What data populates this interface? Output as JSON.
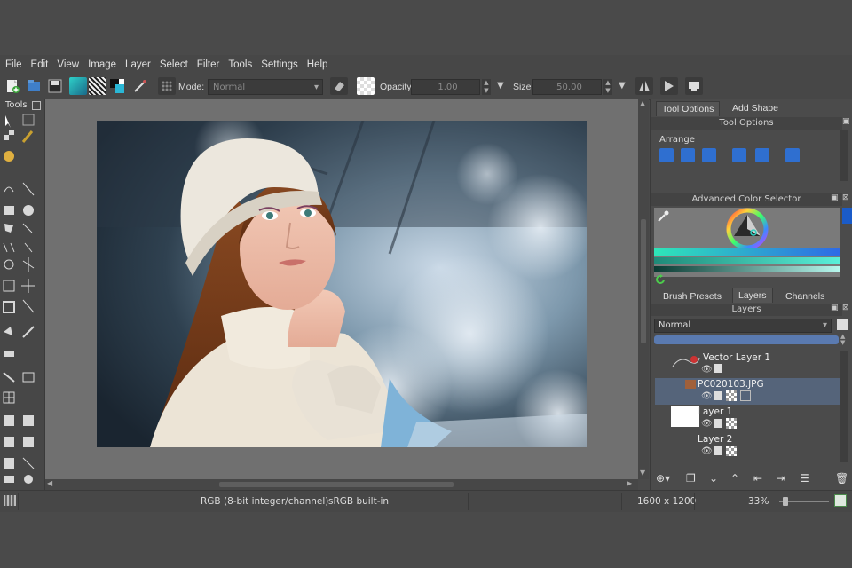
{
  "menu": [
    "File",
    "Edit",
    "View",
    "Image",
    "Layer",
    "Select",
    "Filter",
    "Tools",
    "Settings",
    "Help"
  ],
  "toolbar": {
    "mode_label": "Mode:",
    "mode_value": "Normal",
    "opacity_label": "Opacity:",
    "opacity_value": "1.00",
    "size_label": "Size:",
    "size_value": "50.00"
  },
  "toolbox": {
    "title": "Tools"
  },
  "docker": {
    "tabs_top": [
      "Tool Options",
      "Add Shape"
    ],
    "tool_options_title": "Tool Options",
    "arrange_label": "Arrange",
    "color_selector_title": "Advanced Color Selector",
    "tabs_mid": [
      "Brush Presets",
      "Layers",
      "Channels"
    ],
    "layers_title": "Layers",
    "blend_mode": "Normal",
    "layers": [
      {
        "name": "Vector Layer 1"
      },
      {
        "name": "PC020103.JPG",
        "selected": true
      },
      {
        "name": "Layer 1"
      },
      {
        "name": "Layer 2"
      }
    ]
  },
  "status": {
    "color_model": "RGB (8-bit integer/channel)",
    "profile": "sRGB built-in",
    "dimensions": "1600 x 1200",
    "zoom": "33%"
  },
  "colors": {
    "accent": "#5a6b86",
    "background": "#4a4a4a"
  }
}
